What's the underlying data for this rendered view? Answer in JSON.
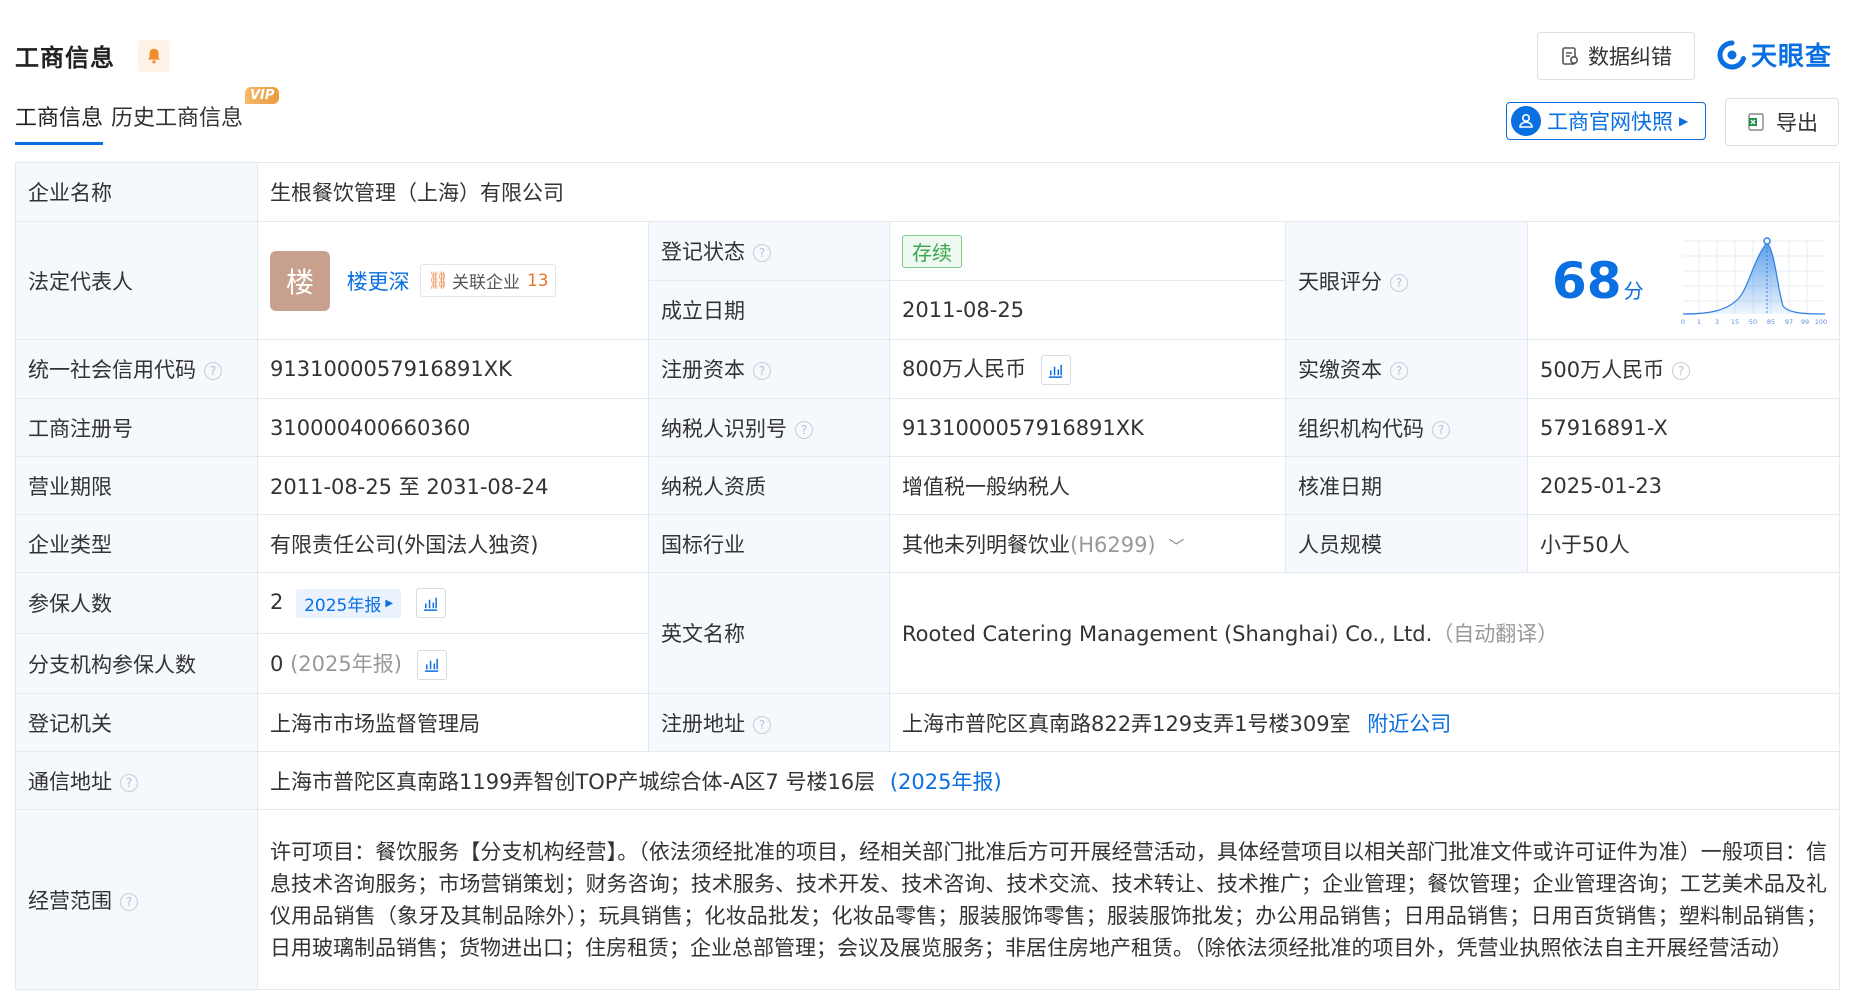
{
  "header": {
    "title": "工商信息",
    "data_correction": "数据纠错",
    "brand": "天眼查"
  },
  "tabs": [
    {
      "label": "工商信息"
    },
    {
      "label": "历史工商信息",
      "badge": "VIP"
    }
  ],
  "actions": {
    "snapshot": "工商官网快照",
    "export": "导出"
  },
  "info": {
    "company_name": {
      "label": "企业名称",
      "value": "生根餐饮管理（上海）有限公司"
    },
    "legal_rep": {
      "label": "法定代表人",
      "avatar_char": "楼",
      "name": "楼更深",
      "related_label": "关联企业",
      "related_count": "13"
    },
    "reg_status": {
      "label": "登记状态",
      "value": "存续"
    },
    "founded": {
      "label": "成立日期",
      "value": "2011-08-25"
    },
    "tianyan_score": {
      "label": "天眼评分",
      "value": "68",
      "unit": "分",
      "axis": [
        "0",
        "1",
        "3",
        "15",
        "50",
        "85",
        "97",
        "99",
        "100"
      ]
    },
    "credit_code": {
      "label": "统一社会信用代码",
      "value": "9131000057916891XK"
    },
    "reg_capital": {
      "label": "注册资本",
      "value": "800万人民币"
    },
    "paid_capital": {
      "label": "实缴资本",
      "value": "500万人民币"
    },
    "reg_number": {
      "label": "工商注册号",
      "value": "310000400660360"
    },
    "taxpayer_id": {
      "label": "纳税人识别号",
      "value": "9131000057916891XK"
    },
    "org_code": {
      "label": "组织机构代码",
      "value": "57916891-X"
    },
    "term": {
      "label": "营业期限",
      "value": "2011-08-25 至 2031-08-24"
    },
    "tax_qual": {
      "label": "纳税人资质",
      "value": "增值税一般纳税人"
    },
    "approve_date": {
      "label": "核准日期",
      "value": "2025-01-23"
    },
    "company_type": {
      "label": "企业类型",
      "value": "有限责任公司(外国法人独资)"
    },
    "industry": {
      "label": "国标行业",
      "value": "其他未列明餐饮业",
      "code": "(H6299)"
    },
    "staff_size": {
      "label": "人员规模",
      "value": "小于50人"
    },
    "insured": {
      "label": "参保人数",
      "value": "2",
      "report": "2025年报"
    },
    "branch_insured": {
      "label": "分支机构参保人数",
      "value": "0",
      "report": "(2025年报)"
    },
    "english_name": {
      "label": "英文名称",
      "value": "Rooted Catering Management (Shanghai) Co., Ltd.",
      "note": "（自动翻译）"
    },
    "authority": {
      "label": "登记机关",
      "value": "上海市市场监督管理局"
    },
    "reg_address": {
      "label": "注册地址",
      "value": "上海市普陀区真南路822弄129支弄1号楼309室",
      "link": "附近公司"
    },
    "contact_address": {
      "label": "通信地址",
      "value": "上海市普陀区真南路1199弄智创TOP产城综合体-A区7 号楼16层",
      "report": "(2025年报)"
    },
    "scope": {
      "label": "经营范围",
      "value": "许可项目：餐饮服务【分支机构经营】。（依法须经批准的项目，经相关部门批准后方可开展经营活动，具体经营项目以相关部门批准文件或许可证件为准）一般项目：信息技术咨询服务；市场营销策划；财务咨询；技术服务、技术开发、技术咨询、技术交流、技术转让、技术推广；企业管理；餐饮管理；企业管理咨询；工艺美术品及礼仪用品销售（象牙及其制品除外）；玩具销售；化妆品批发；化妆品零售；服装服饰零售；服装服饰批发；办公用品销售；日用品销售；日用百货销售；塑料制品销售；日用玻璃制品销售；货物进出口；住房租赁；企业总部管理；会议及展览服务；非居住房地产租赁。（除依法须经批准的项目外，凭营业执照依法自主开展经营活动）"
    }
  },
  "colors": {
    "accent": "#0a6fe0",
    "label_bg": "#f5f8fc",
    "status_green": "#39a552",
    "vip_orange": "#e99b3d"
  }
}
